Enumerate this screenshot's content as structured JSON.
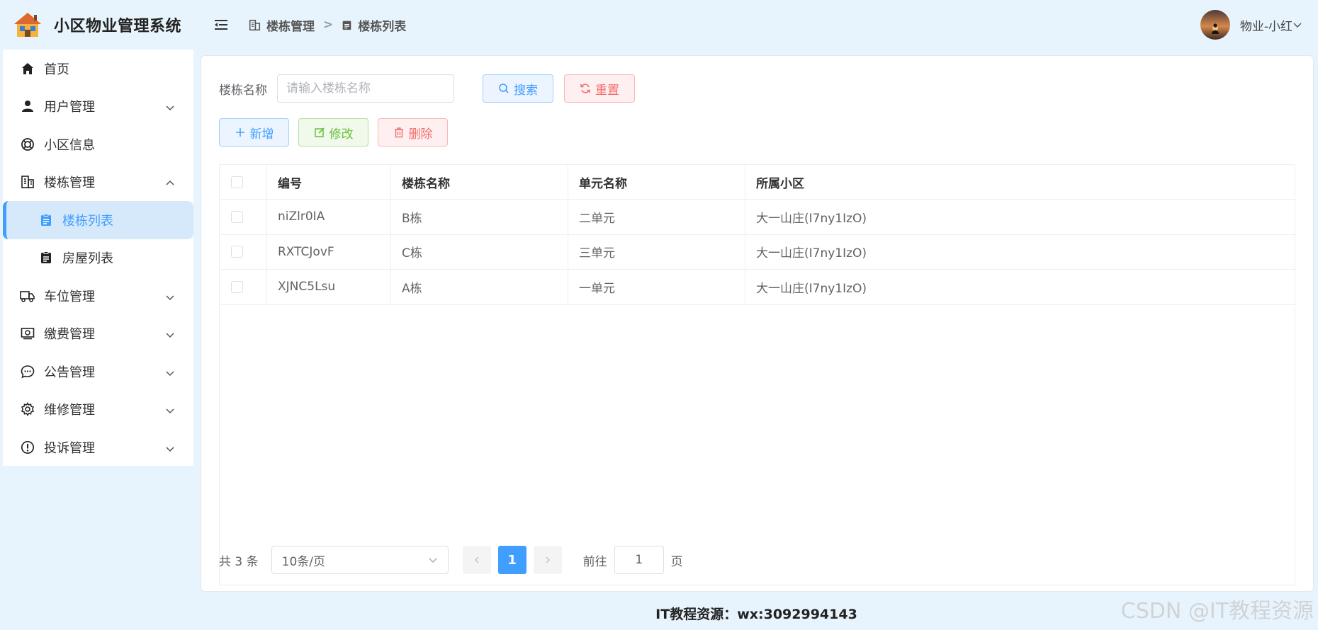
{
  "app": {
    "title": "小区物业管理系统"
  },
  "sidebar": {
    "items": [
      {
        "label": "首页"
      },
      {
        "label": "用户管理"
      },
      {
        "label": "小区信息"
      },
      {
        "label": "楼栋管理"
      },
      {
        "label": "楼栋列表"
      },
      {
        "label": "房屋列表"
      },
      {
        "label": "车位管理"
      },
      {
        "label": "缴费管理"
      },
      {
        "label": "公告管理"
      },
      {
        "label": "维修管理"
      },
      {
        "label": "投诉管理"
      }
    ]
  },
  "header": {
    "breadcrumb": [
      "楼栋管理",
      "楼栋列表"
    ],
    "separator": ">",
    "user_name": "物业-小红"
  },
  "search": {
    "label": "楼栋名称",
    "placeholder": "请输入楼栋名称",
    "search_label": "搜索",
    "reset_label": "重置"
  },
  "actions": {
    "add_label": "新增",
    "edit_label": "修改",
    "delete_label": "删除"
  },
  "table": {
    "columns": [
      "编号",
      "楼栋名称",
      "单元名称",
      "所属小区"
    ],
    "rows": [
      [
        "niZlr0IA",
        "B栋",
        "二单元",
        "大一山庄(I7ny1IzO)"
      ],
      [
        "RXTCJovF",
        "C栋",
        "三单元",
        "大一山庄(I7ny1IzO)"
      ],
      [
        "XJNC5Lsu",
        "A栋",
        "一单元",
        "大一山庄(I7ny1IzO)"
      ]
    ]
  },
  "pagination": {
    "total_text": "共 3 条",
    "page_size": "10条/页",
    "current_page": "1",
    "goto_label": "前往",
    "goto_value": "1",
    "page_unit": "页"
  },
  "footer": {
    "text": "IT教程资源：wx:3092994143"
  },
  "watermark": {
    "text": "CSDN @IT教程资源"
  },
  "colors": {
    "primary": "#409eff",
    "success": "#67c23a",
    "danger": "#f56c6c",
    "background": "#e8f4fd"
  }
}
